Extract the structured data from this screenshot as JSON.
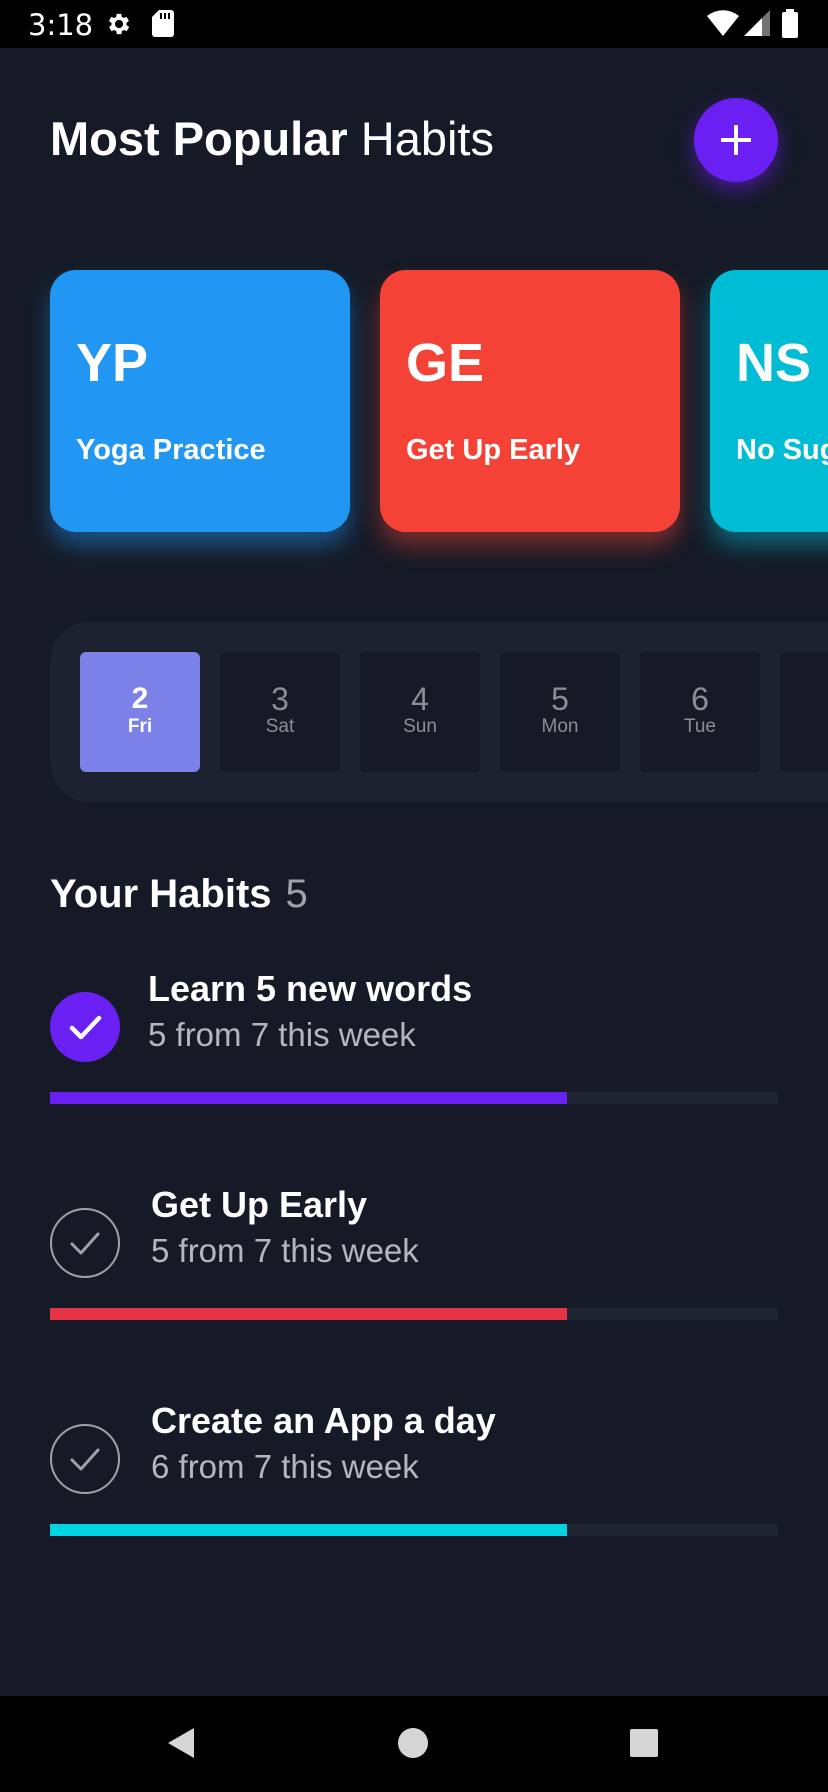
{
  "status_bar": {
    "time": "3:18",
    "icons": [
      "gear-icon",
      "sd-card-icon",
      "wifi-icon",
      "signal-icon",
      "battery-icon"
    ]
  },
  "header": {
    "title_bold": "Most Popular",
    "title_light": "Habits",
    "add_button_icon": "plus-icon"
  },
  "popular_habits": [
    {
      "initials": "YP",
      "name": "Yoga Practice",
      "color": "#2196f3"
    },
    {
      "initials": "GE",
      "name": "Get Up Early",
      "color": "#f44336"
    },
    {
      "initials": "NS",
      "name": "No Sug",
      "color": "#00bcd4"
    }
  ],
  "days": [
    {
      "num": "2",
      "dow": "Fri",
      "selected": true
    },
    {
      "num": "3",
      "dow": "Sat",
      "selected": false
    },
    {
      "num": "4",
      "dow": "Sun",
      "selected": false
    },
    {
      "num": "5",
      "dow": "Mon",
      "selected": false
    },
    {
      "num": "6",
      "dow": "Tue",
      "selected": false
    }
  ],
  "your_habits": {
    "heading": "Your Habits",
    "count": "5",
    "items": [
      {
        "title": "Learn 5 new words",
        "progress_text": "5 from 7 this week",
        "progress": 0.71,
        "color": "#6a1ff3",
        "done": true
      },
      {
        "title": "Get Up Early",
        "progress_text": "5 from 7 this week",
        "progress": 0.71,
        "color": "#e53444",
        "done": false
      },
      {
        "title": "Create an App a day",
        "progress_text": "6 from 7 this week",
        "progress": 0.71,
        "color": "#00d4e0",
        "done": false
      }
    ]
  },
  "nav_bar": {
    "icons": [
      "back-icon",
      "home-icon",
      "recents-icon"
    ]
  }
}
